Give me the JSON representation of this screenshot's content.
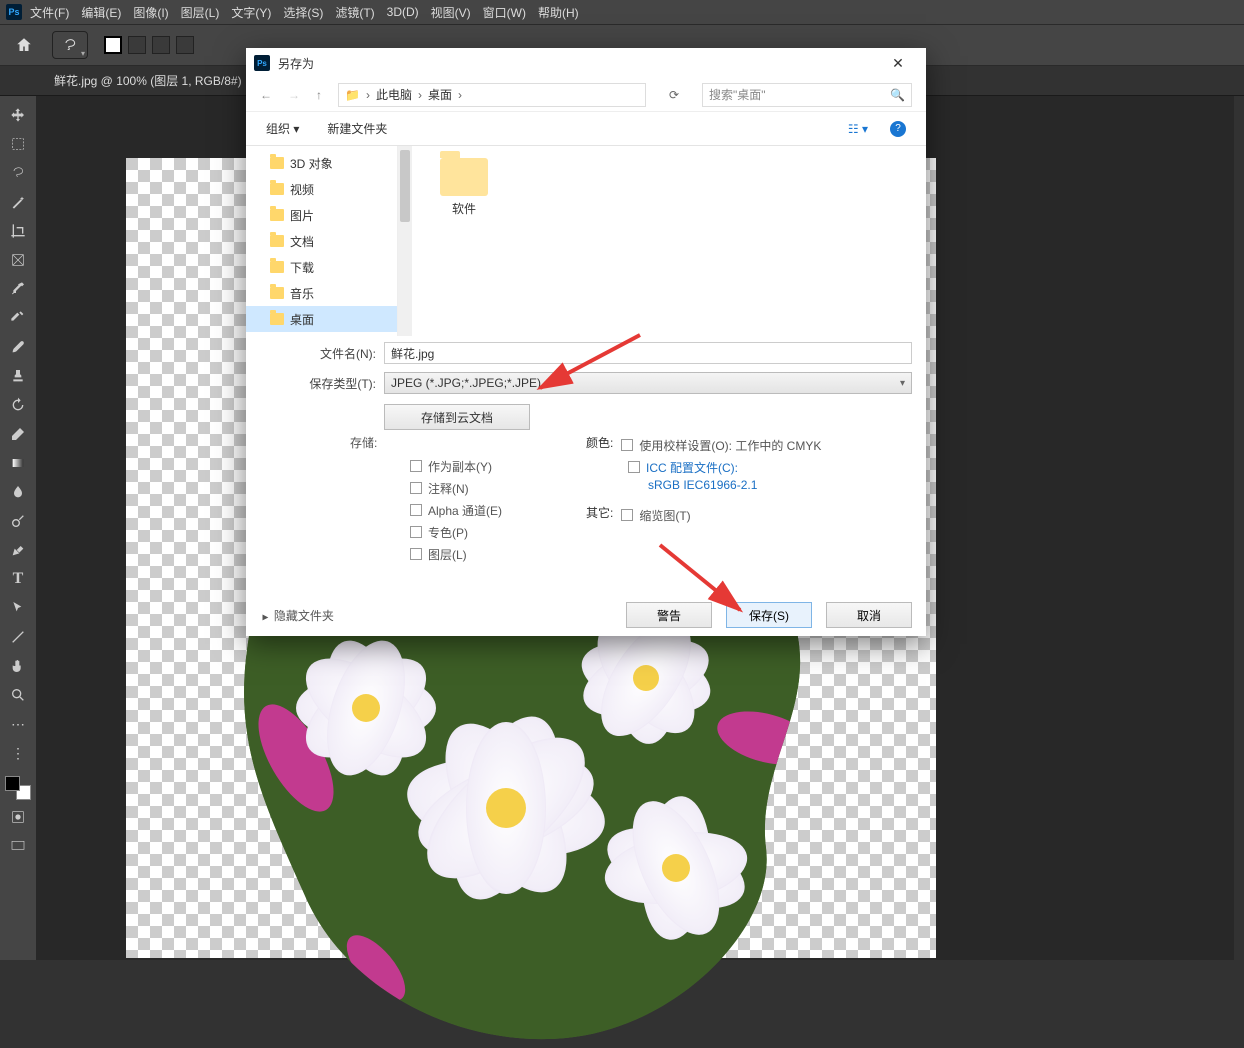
{
  "menu": {
    "file": "文件(F)",
    "edit": "编辑(E)",
    "image": "图像(I)",
    "layer": "图层(L)",
    "type": "文字(Y)",
    "select": "选择(S)",
    "filter": "滤镜(T)",
    "3d": "3D(D)",
    "view": "视图(V)",
    "window": "窗口(W)",
    "help": "帮助(H)"
  },
  "tab_title": "鲜花.jpg @ 100% (图层 1, RGB/8#)",
  "dialog": {
    "title": "另存为",
    "breadcrumb": {
      "pc": "此电脑",
      "desktop": "桌面"
    },
    "search_placeholder": "搜索\"桌面\"",
    "organize": "组织 ▾",
    "new_folder": "新建文件夹",
    "tree": {
      "3d": "3D 对象",
      "video": "视频",
      "pictures": "图片",
      "documents": "文档",
      "downloads": "下载",
      "music": "音乐",
      "desktop": "桌面"
    },
    "folder_label": "软件",
    "filename_label": "文件名(N):",
    "filename_value": "鲜花.jpg",
    "filetype_label": "保存类型(T):",
    "filetype_value": "JPEG (*.JPG;*.JPEG;*.JPE)",
    "cloud_btn": "存储到云文档",
    "save_opts_label": "存储:",
    "as_copy": "作为副本(Y)",
    "annotations": "注释(N)",
    "alpha": "Alpha 通道(E)",
    "spot": "专色(P)",
    "layers": "图层(L)",
    "color_label": "颜色:",
    "use_proof": "使用校样设置(O):  工作中的 CMYK",
    "icc": "ICC 配置文件(C):",
    "icc2": "sRGB IEC61966-2.1",
    "other_label": "其它:",
    "thumbnail": "缩览图(T)",
    "hide_folders": "隐藏文件夹",
    "warn": "警告",
    "save": "保存(S)",
    "cancel": "取消"
  }
}
